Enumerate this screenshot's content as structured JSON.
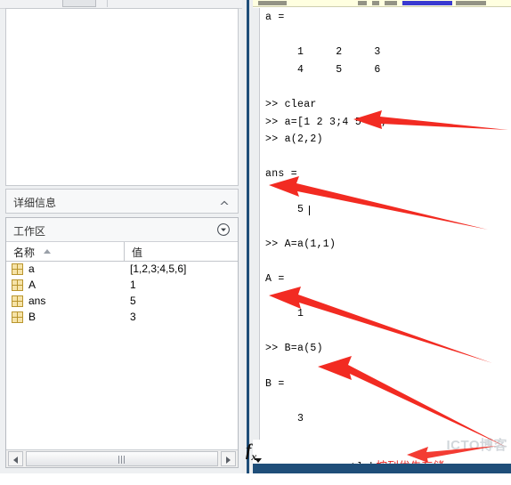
{
  "left_panel": {
    "detail": {
      "title": "详细信息",
      "collapse_icon": "chevron-up-icon"
    },
    "workspace": {
      "title": "工作区",
      "menu_icon": "circled-chevron-down-icon",
      "columns": [
        "名称",
        "值"
      ],
      "sort_indicator": "sort-ascending-icon",
      "rows": [
        {
          "icon": "matrix-variable-icon",
          "name": "a",
          "value": "[1,2,3;4,5,6]"
        },
        {
          "icon": "matrix-variable-icon",
          "name": "A",
          "value": "1"
        },
        {
          "icon": "matrix-variable-icon",
          "name": "ans",
          "value": "5"
        },
        {
          "icon": "matrix-variable-icon",
          "name": "B",
          "value": "3"
        }
      ],
      "scrollbar": {
        "left_icon": "triangle-left-icon",
        "right_icon": "triangle-right-icon",
        "grip_icon": "grip-icon"
      }
    }
  },
  "command_window": {
    "lines": [
      "a =",
      "",
      "     1     2     3",
      "     4     5     6",
      "",
      ">> clear",
      ">> a=[1 2 3;4 5 6];",
      ">> a(2,2)",
      "",
      "ans =",
      "",
      "     5",
      "",
      ">> A=a(1,1)",
      "",
      "A =",
      "",
      "     1",
      "",
      ">> B=a(5)",
      "",
      "B =",
      "",
      "     3"
    ],
    "prompt": {
      "fx_icon": "fx-function-icon",
      "prompt_symbol": ">>",
      "typed_text": "matlab",
      "annotation_text": "按列优先存储"
    },
    "watermark": "ICTO博客"
  },
  "annotations": {
    "color": "#f22b22",
    "arrow_icon": "arrow-left-icon",
    "count": 4
  },
  "splitter": {
    "icon": "vertical-splitter-handle",
    "color": "#1f4e79"
  }
}
